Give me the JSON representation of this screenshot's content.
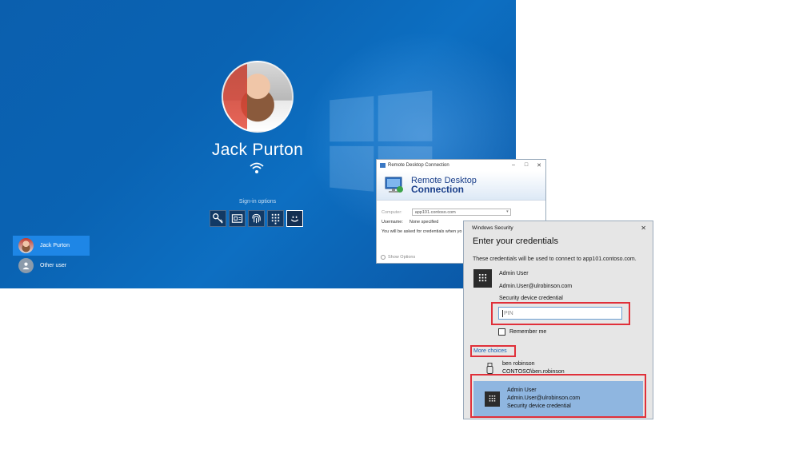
{
  "lock_screen": {
    "user_name": "Jack Purton",
    "signin_options_label": "Sign-in options",
    "signin_options": [
      {
        "name": "key-icon"
      },
      {
        "name": "smart-card-icon"
      },
      {
        "name": "fingerprint-icon"
      },
      {
        "name": "keypad-icon"
      },
      {
        "name": "face-icon",
        "selected": true
      }
    ],
    "users": [
      {
        "label": "Jack Purton",
        "active": true
      },
      {
        "label": "Other user",
        "active": false
      }
    ],
    "colors": {
      "background": "#0a63b3",
      "active_tile": "#1e86e6"
    }
  },
  "rdp_window": {
    "title": "Remote Desktop Connection",
    "banner_line1": "Remote Desktop",
    "banner_line2": "Connection",
    "computer_label": "Computer:",
    "computer_value": "app101.contoso.com",
    "username_label": "Username:",
    "username_value": "None specified",
    "info_text": "You will be asked for credentials when yo",
    "show_options": "Show Options",
    "controls": {
      "minimize": "–",
      "maximize": "□",
      "close": "✕"
    }
  },
  "windows_security": {
    "title": "Windows Security",
    "close": "✕",
    "heading": "Enter your credentials",
    "description": "These credentials will be used to connect to app101.contoso.com.",
    "selected_credential": {
      "name": "Admin User",
      "email": "Admin.User@ulrobinson.com",
      "field_label": "Security device credential",
      "pin_placeholder": "PIN"
    },
    "remember_me": "Remember me",
    "more_choices": "More choices",
    "other_credentials": [
      {
        "name": "ben robinson",
        "account": "CONTOSO\\ben.robinson"
      }
    ],
    "admin_option": {
      "name": "Admin User",
      "email": "Admin.User@ulrobinson.com",
      "type": "Security device credential"
    },
    "colors": {
      "highlight": "#e0303a",
      "tile": "#8fb6e0",
      "link": "#1a5fb4"
    }
  }
}
